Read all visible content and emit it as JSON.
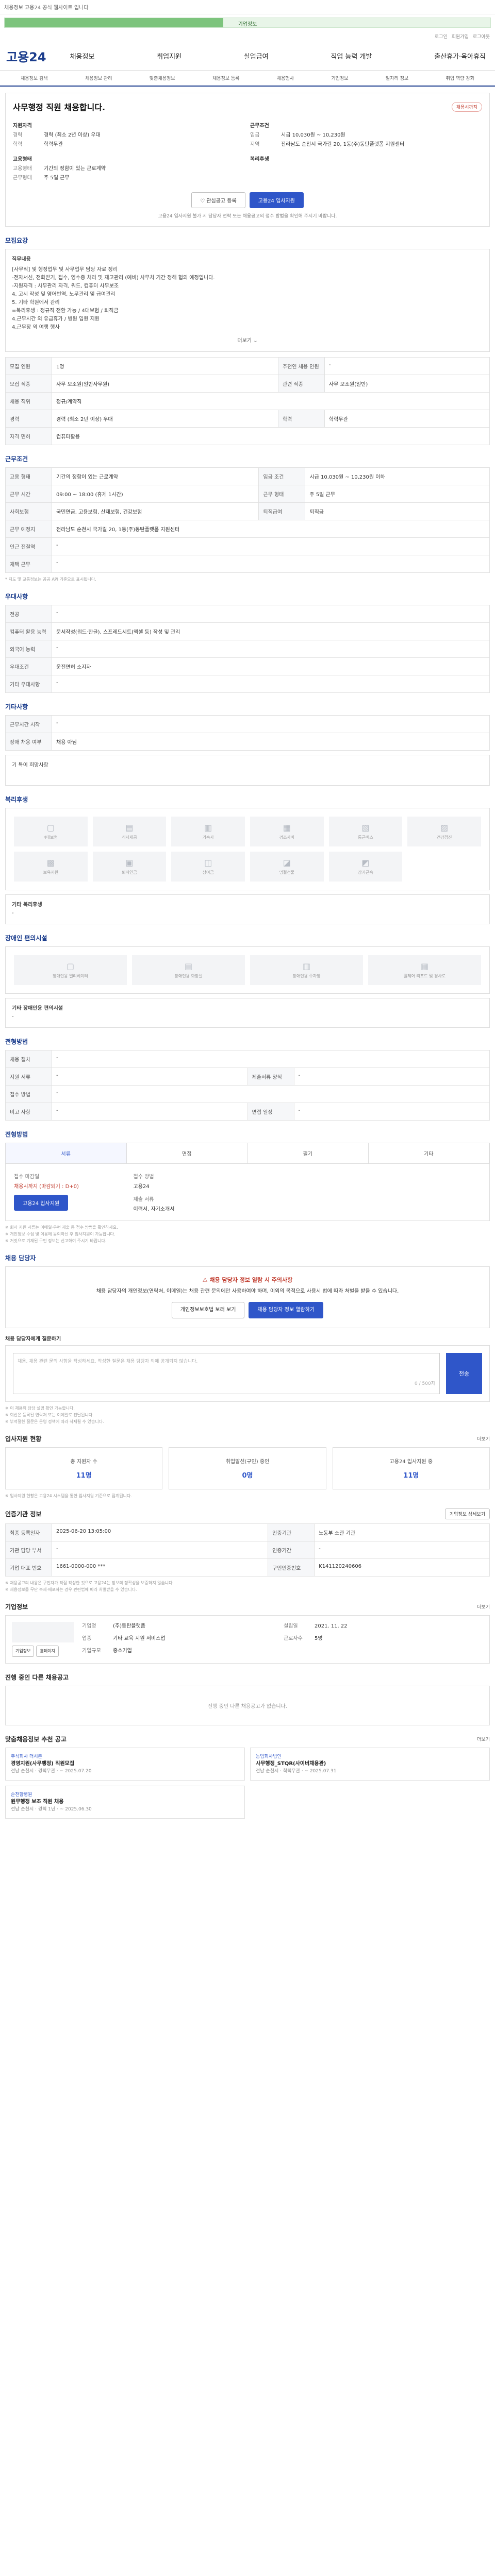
{
  "topbar": {
    "text": "채용정보 고용24 공식 웹사이트 입니다"
  },
  "progress": {
    "label": "기업정보",
    "percent": 45
  },
  "util": [
    "로그인",
    "회원가입",
    "로그아웃"
  ],
  "header": {
    "logo": "고용24",
    "gnb": [
      "채용정보",
      "취업지원",
      "실업급여",
      "직업 능력 개발",
      "출산휴가·육아휴직"
    ]
  },
  "subnav": [
    "채용정보 검색",
    "채용정보 관리",
    "맞춤채용정보",
    "채용정보 등록",
    "채용행사",
    "기업정보",
    "일자리 정보",
    "취업 역량 강화"
  ],
  "job": {
    "tag": "채용시까지",
    "title": "사무행정 직원 채용합니다.",
    "company_label": "지원자격",
    "left": [
      {
        "k": "경력",
        "v": "경력 (최소 2년 이상) 우대"
      },
      {
        "k": "학력",
        "v": "학력무관"
      }
    ],
    "cond_label": "근무조건",
    "right": [
      {
        "k": "임금",
        "v": "시급 10,030원 ~ 10,230원"
      },
      {
        "k": "지역",
        "v": "전라남도 순천시 국가길 20, 1동(주)동탄플랫폼 지원센터"
      }
    ],
    "emp_label": "고용형태",
    "emp": [
      {
        "k": "고용형태",
        "v": "기간의 정함이 있는 근로계약"
      },
      {
        "k": "근무형태",
        "v": "주 5일 근무"
      }
    ],
    "welfare_label": "복리후생",
    "btn_interest": "관심공고 등록",
    "btn_apply": "고용24 입사지원",
    "note": "고용24 입사지원 불가 시 담당자 연락 또는 채용공고의 접수 방법을 확인해 주시기 바랍니다."
  },
  "recruit": {
    "title": "모집요강",
    "duty_label": "직무내용",
    "duty": "[사무직] 및 행정업무 및 사무업무 담당 자료 정리\n-전자서신, 전화받기, 접수, 영수증 처리 및 재고관리 (예비) 사무처 기간 정해 협의 예정입니다.\n-지원자격 : 사무관리 자격, 워드, 컴퓨터 사무보조\n   4. 고시 작성 및 영어번역, 노무관리 및 급여관리\n   5. 기타 학원에서 관리\n=복리후생 : 정규직 전환 가능 / 4대보험 / 퇴직금\n   4.근무시간 외 유급휴가 / 병원 입원 지원\n   4.근무장 외 여행 행사",
    "more": "더보기",
    "rows": [
      [
        "모집 인원",
        "1명",
        "추천인 채용 인원",
        "-"
      ],
      [
        "모집 직종",
        "사무 보조원(일반사무원)",
        "관련 직종",
        "사무 보조원(일반)"
      ],
      [
        "채용 직위",
        "정규/계약직",
        "",
        ""
      ],
      [
        "경력",
        "경력 (최소 2년 이상) 우대",
        "학력",
        "학력무관"
      ],
      [
        "자격 면허",
        "컴퓨터활용",
        "",
        ""
      ]
    ]
  },
  "cond": {
    "title": "근무조건",
    "rows": [
      [
        "고용 형태",
        "기간의 정함이 있는 근로계약",
        "임금 조건",
        "시급 10,030원 ~ 10,230원 이하"
      ],
      [
        "근무 시간",
        "09:00 ~ 18:00 (휴게 1시간)",
        "근무 형태",
        "주 5일 근무"
      ],
      [
        "사회보험",
        "국민연금, 고용보험, 산재보험, 건강보험",
        "퇴직급여",
        "퇴직금"
      ],
      [
        "근무 예정지",
        "전라남도 순천시 국가길 20, 1동(주)동탄플랫폼 지원센터",
        "",
        ""
      ],
      [
        "인근 전철역",
        "-",
        "",
        ""
      ],
      [
        "재택 근무",
        "-",
        "",
        ""
      ]
    ],
    "footnote": "* 지도 및 교통정보는 공공 API 기준으로 표시됩니다."
  },
  "preference": {
    "title": "우대사항",
    "rows": [
      [
        "전공",
        "-"
      ],
      [
        "컴퓨터 활용 능력",
        "문서작성(워드·한글), 스프레드시트(엑셀 등) 작성 및 관리"
      ],
      [
        "외국어 능력",
        "-"
      ],
      [
        "우대조건",
        "운전면허 소지자"
      ],
      [
        "기타 우대사항",
        "-"
      ]
    ]
  },
  "other": {
    "title": "기타사항",
    "rows": [
      [
        "근무시간 시작",
        "-"
      ],
      [
        "장애 채용 여부",
        "채용 아님"
      ]
    ],
    "note_label": "기 특이 희망사항"
  },
  "welfare": {
    "title": "복리후생",
    "icons": [
      {
        "name": "meal-icon",
        "glyph": "▢",
        "label": "4대보험"
      },
      {
        "name": "bus-icon",
        "glyph": "▤",
        "label": "식사제공"
      },
      {
        "name": "dorm-icon",
        "glyph": "▥",
        "label": "기숙사"
      },
      {
        "name": "gift-icon",
        "glyph": "▦",
        "label": "경조사비"
      },
      {
        "name": "car-icon",
        "glyph": "▧",
        "label": "통근버스"
      },
      {
        "name": "health-icon",
        "glyph": "▨",
        "label": "건강검진"
      },
      {
        "name": "child-icon",
        "glyph": "▩",
        "label": "보육지원"
      },
      {
        "name": "pension-icon",
        "glyph": "▣",
        "label": "퇴직연금"
      },
      {
        "name": "bonus-icon",
        "glyph": "◫",
        "label": "상여금"
      },
      {
        "name": "allowance-icon",
        "glyph": "◪",
        "label": "명절선물"
      },
      {
        "name": "leave-icon",
        "glyph": "◩",
        "label": "장기근속"
      }
    ],
    "extra_label": "기타 복리후생",
    "extra": "-"
  },
  "disability": {
    "title": "장애인 편의시설",
    "icons": [
      {
        "name": "elevator-icon",
        "glyph": "▢",
        "label": "장애인용 엘리베이터"
      },
      {
        "name": "toilet-icon",
        "glyph": "▤",
        "label": "장애인용 화장실"
      },
      {
        "name": "parking-icon",
        "glyph": "▥",
        "label": "장애인용 주차장"
      },
      {
        "name": "ramp-icon",
        "glyph": "▦",
        "label": "휠체어 리프트 및 경사로"
      }
    ],
    "extra_label": "기타 장애인용 편의시설",
    "extra": "-"
  },
  "process": {
    "title": "전형방법",
    "rows": [
      [
        "채용 절차",
        "-",
        "",
        ""
      ],
      [
        "지원 서류",
        "-",
        "제출서류 양식",
        "-"
      ],
      [
        "접수 방법",
        "-",
        "",
        ""
      ],
      [
        "비고 사항",
        "-",
        "면접 일정",
        "-"
      ]
    ]
  },
  "apply": {
    "title": "전형방법",
    "tabs": [
      "서류",
      "면접",
      "필기",
      "기타"
    ],
    "deadline_label": "접수 마감일",
    "deadline": "채용시까지 (마감되기 : D+0)",
    "method_label": "접수 방법",
    "method": "고용24",
    "btn": "고용24 입사지원",
    "docs_label": "제출 서류",
    "docs": "이력서, 자기소개서",
    "notes": [
      "※ 회사 지원 서류는 이메일·우편 제출 등 접수 방법을 확인하세요.",
      "※ 개인정보 수집 및 이용에 동의하신 후 입사지원이 가능합니다.",
      "※ 거짓으로 기재된 구인 정보는 신고하여 주시기 바랍니다."
    ]
  },
  "contact": {
    "title": "채용 담당자",
    "warn_title": "채용 담당자 정보 열람 시 주의사항",
    "warn_body": "채용 담당자의 개인정보(연락처, 이메일)는 채용 관련 문의에만 사용하여야 하며, 이외의 목적으로 사용시 법에 따라 처벌을 받을 수 있습니다.",
    "btn_view": "개인정보보호법 보러 보기",
    "btn_open": "채용 담당자 정보 열람하기",
    "q_label": "채용 담당자에게 질문하기",
    "q_placeholder": "채용, 채용 관련 문의 사항을 작성하세요. 작성한 질문은 채용 담당자 외에 공개되지 않습니다.",
    "q_count": "0 / 500자",
    "q_btn": "전송",
    "q_notes": [
      "※ 이 채용의 담당 설명 확인 가능합니다.",
      "※ 회신은 등록된 연락처 또는 이메일로 전달됩니다.",
      "※ 부적절한 질문은 운영 정책에 따라 삭제될 수 있습니다."
    ]
  },
  "status": {
    "title": "입사지원 현황",
    "more": "더보기",
    "items": [
      {
        "label": "총 지원자 수",
        "value": "11명"
      },
      {
        "label": "취업알선(구인) 중인",
        "value": "0명"
      },
      {
        "label": "고용24 입사지원 중",
        "value": "11명"
      }
    ],
    "note": "※ 입사지원 현황은 고용24 시스템을 통한 입사지원 기준으로 집계됩니다."
  },
  "company": {
    "title": "인증기관 정보",
    "btn": "기업정보 상세보기",
    "rows": [
      [
        "최종 등록일자",
        "2025-06-20 13:05:00",
        "인증기관",
        "노동부 소관 기관"
      ],
      [
        "기관 담당 부서",
        "-",
        "인증기간",
        "-"
      ],
      [
        "기업 대표 번호",
        "1661-0000-000 ***",
        "구인인증번호",
        "K141120240606"
      ]
    ],
    "notes": [
      "※ 채용공고의 내용은 구인자가 직접 작성한 것으로 고용24는 정보의 정확성을 보증하지 않습니다.",
      "※ 채용정보를 무단 복제·배포하는 경우 관련법에 따라 처벌받을 수 있습니다."
    ]
  },
  "corp": {
    "title": "기업정보",
    "more": "더보기",
    "name_label": "기업명",
    "name": "(주)동탄플랫폼",
    "industry_label": "업종",
    "industry": "기타 교육 지원 서비스업",
    "size_label": "기업규모",
    "size": "중소기업",
    "founded_label": "설립일",
    "founded": "2021. 11. 22",
    "employees_label": "근로자수",
    "employees": "5명",
    "btn_a": "기업정보",
    "btn_b": "홈페이지"
  },
  "similar": {
    "title": "진행 중인 다른 채용공고",
    "empty": "진행 중인 다른 채용공고가 없습니다."
  },
  "recommend": {
    "title": "맞춤채용정보 추천 공고",
    "more": "더보기",
    "items": [
      {
        "co": "주식회사 더시즌",
        "t": "경영지원(사무행정) 직원모집",
        "d": "전남 순천시 · 경력무관 · ~ 2025.07.20"
      },
      {
        "co": "농업회사법인",
        "t": "사무행정_STQR(사이버채용관)",
        "d": "전남 순천시 · 학력무관 · ~ 2025.07.31"
      },
      {
        "co": "순천향병원",
        "t": "원무행정 보조 직원 채용",
        "d": "전남 순천시 · 경력 1년 · ~ 2025.06.30"
      }
    ]
  }
}
